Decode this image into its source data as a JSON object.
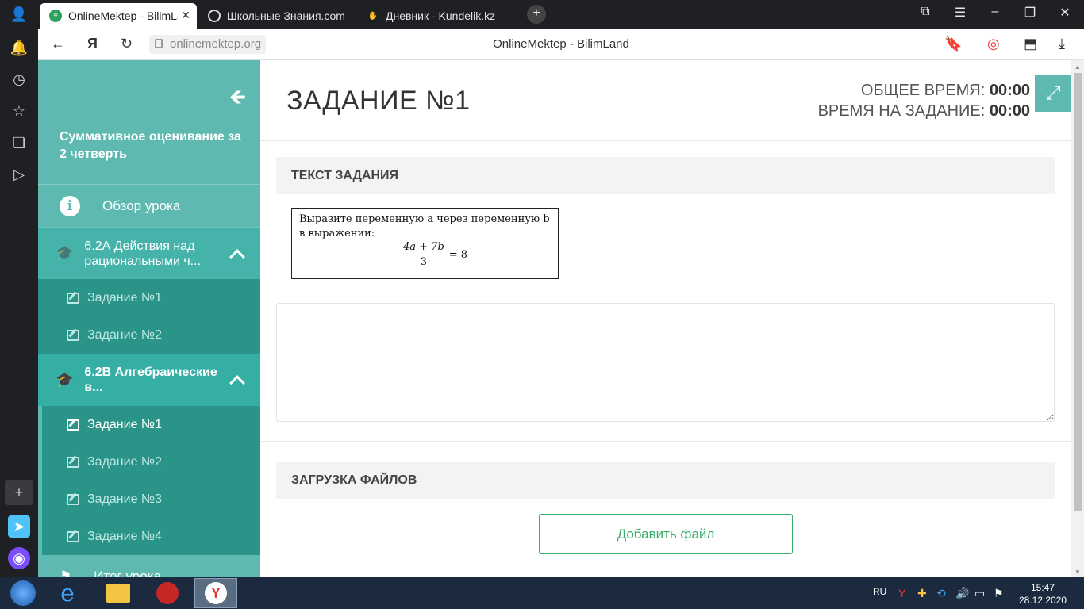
{
  "browser": {
    "tabs": [
      {
        "label": "OnlineMektep - BilimLa",
        "active": true
      },
      {
        "label": "Школьные Знания.com - Р",
        "active": false
      },
      {
        "label": "Дневник - Kundelik.kz",
        "active": false
      }
    ],
    "url": "onlinemektep.org",
    "page_title": "OnlineMektep - BilimLand"
  },
  "sidebar": {
    "title": "Суммативное оценивание за 2 четверть",
    "overview_label": "Обзор урока",
    "sections": [
      {
        "label": "6.2А Действия над рациональными ч...",
        "items": [
          "Задание №1",
          "Задание №2"
        ]
      },
      {
        "label": "6.2В Алгебраические в...",
        "items": [
          "Задание №1",
          "Задание №2",
          "Задание №3",
          "Задание №4"
        ]
      }
    ],
    "footer_label": "Итог урока"
  },
  "main": {
    "task_title": "ЗАДАНИЕ №1",
    "total_time_label": "ОБЩЕЕ ВРЕМЯ:",
    "total_time_value": "00:00",
    "task_time_label": "ВРЕМЯ НА ЗАДАНИЕ:",
    "task_time_value": "00:00",
    "task_text_heading": "ТЕКСТ ЗАДАНИЯ",
    "task_text": "Выразите переменную a через переменную b в выражении:",
    "formula_numerator": "4a + 7b",
    "formula_denominator": "3",
    "formula_rhs": "= 8",
    "answer_value": "",
    "upload_heading": "ЗАГРУЗКА ФАЙЛОВ",
    "add_file_label": "Добавить файл"
  },
  "taskbar": {
    "language": "RU",
    "time": "15:47",
    "date": "28.12.2020"
  },
  "colors": {
    "sidebar_bg": "#5ebab1",
    "sidebar_section_bg": "#45b3aa",
    "sidebar_sub_bg": "#2a9488",
    "accent_green": "#3bab6a"
  }
}
